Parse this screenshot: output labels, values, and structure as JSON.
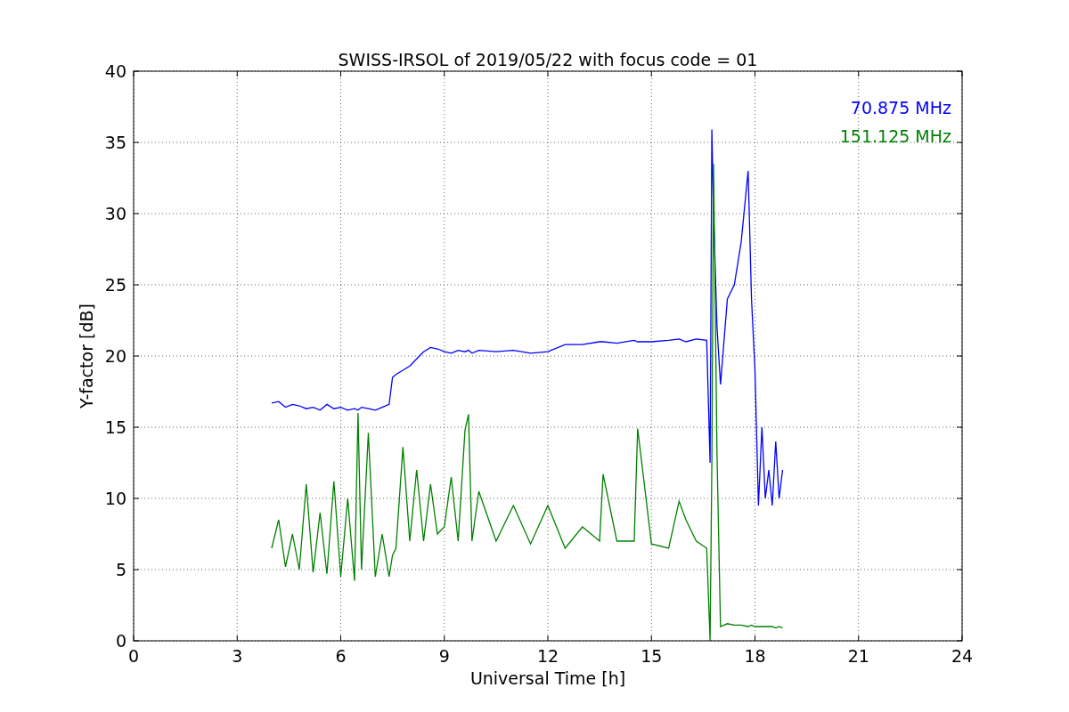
{
  "figure": {
    "chart_data": {
      "type": "line",
      "grid": true,
      "title": "SWISS-IRSOL of 2019/05/22 with focus code = 01",
      "xlabel": "Universal Time [h]",
      "ylabel": "Y-factor [dB]",
      "xlim": [
        0,
        24
      ],
      "ylim": [
        0,
        40
      ],
      "xticks": [
        0,
        3,
        6,
        9,
        12,
        15,
        18,
        21,
        24
      ],
      "yticks": [
        0,
        5,
        10,
        15,
        20,
        25,
        30,
        35,
        40
      ],
      "x": [
        4.0,
        4.2,
        4.4,
        4.6,
        4.8,
        5.0,
        5.2,
        5.4,
        5.6,
        5.8,
        6.0,
        6.2,
        6.4,
        6.5,
        6.6,
        6.8,
        7.0,
        7.2,
        7.4,
        7.5,
        7.6,
        7.8,
        8.0,
        8.2,
        8.4,
        8.6,
        8.8,
        9.0,
        9.2,
        9.4,
        9.6,
        9.7,
        9.8,
        10.0,
        10.5,
        11.0,
        11.5,
        12.0,
        12.5,
        13.0,
        13.5,
        13.6,
        14.0,
        14.5,
        14.6,
        15.0,
        15.5,
        15.8,
        16.0,
        16.3,
        16.6,
        16.7,
        16.75,
        16.8,
        16.9,
        17.0,
        17.2,
        17.4,
        17.6,
        17.8,
        17.9,
        18.0,
        18.1,
        18.2,
        18.3,
        18.4,
        18.5,
        18.6,
        18.7,
        18.8
      ],
      "series": [
        {
          "name": "70.875 MHz",
          "color": "#0000ff",
          "values": [
            16.7,
            16.8,
            16.4,
            16.6,
            16.5,
            16.3,
            16.4,
            16.2,
            16.6,
            16.3,
            16.4,
            16.2,
            16.3,
            16.2,
            16.4,
            16.3,
            16.2,
            16.4,
            16.6,
            18.5,
            18.7,
            19.0,
            19.3,
            19.8,
            20.3,
            20.6,
            20.5,
            20.3,
            20.2,
            20.4,
            20.3,
            20.4,
            20.2,
            20.4,
            20.3,
            20.4,
            20.2,
            20.3,
            20.8,
            20.8,
            21.0,
            21.0,
            20.9,
            21.1,
            21.0,
            21.0,
            21.1,
            21.2,
            21.0,
            21.2,
            21.1,
            12.5,
            35.9,
            30,
            22,
            18,
            24,
            25,
            28,
            33,
            24,
            19,
            9.5,
            15,
            10,
            12,
            9.5,
            14,
            10,
            12
          ]
        },
        {
          "name": "151.125 MHz",
          "color": "#008000",
          "values": [
            6.5,
            8.5,
            5.2,
            7.5,
            5.0,
            11,
            4.8,
            9,
            4.7,
            11.2,
            4.5,
            10,
            4.2,
            16,
            5.0,
            14.6,
            4.5,
            7.5,
            4.5,
            6.0,
            6.5,
            13.6,
            7.0,
            12.0,
            7.0,
            11,
            7.5,
            8.0,
            11.5,
            7.0,
            14.8,
            15.9,
            7.0,
            10.5,
            7.0,
            9.5,
            6.8,
            9.5,
            6.5,
            8.0,
            7.0,
            11.7,
            7.0,
            7.0,
            14.9,
            6.8,
            6.5,
            9.8,
            8.5,
            7.0,
            6.5,
            0,
            12.5,
            33.5,
            13,
            1.0,
            1.2,
            1.1,
            1.1,
            1.0,
            1.1,
            1.0,
            1.0,
            1.0,
            1.0,
            1.0,
            1.0,
            0.9,
            1.0,
            0.9
          ]
        }
      ]
    }
  }
}
